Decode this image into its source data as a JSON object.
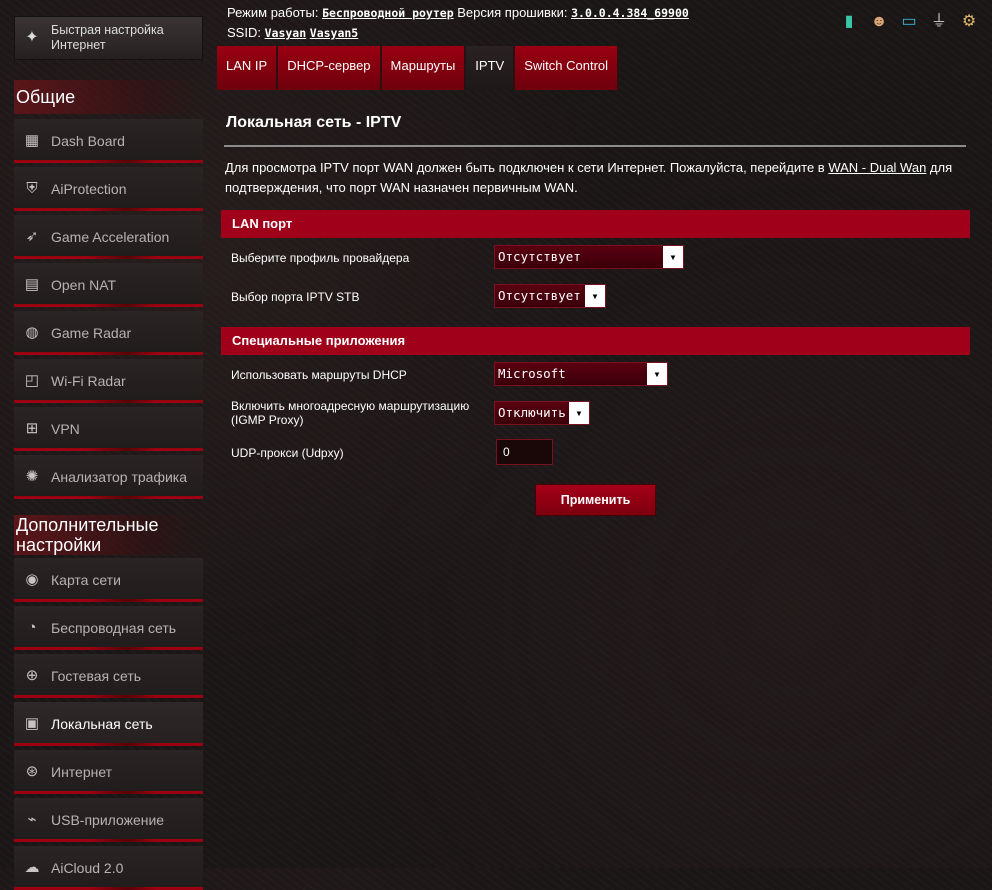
{
  "sidebar": {
    "quick_setup": {
      "label_line1": "Быстрая настройка",
      "label_line2": "Интернет",
      "icon": "wand-icon"
    },
    "general_title": "Общие",
    "general_items": [
      {
        "label": "Dash Board",
        "icon": "dashboard-icon"
      },
      {
        "label": "AiProtection",
        "icon": "shield-icon"
      },
      {
        "label": "Game Acceleration",
        "icon": "rocket-icon"
      },
      {
        "label": "Open NAT",
        "icon": "router-icon"
      },
      {
        "label": "Game Radar",
        "icon": "radar-icon"
      },
      {
        "label": "Wi-Fi Radar",
        "icon": "wifi-radar-icon"
      },
      {
        "label": "VPN",
        "icon": "vpn-icon"
      },
      {
        "label": "Анализатор трафика",
        "icon": "traffic-analyzer-icon"
      }
    ],
    "advanced_title_line1": "Дополнительные",
    "advanced_title_line2": "настройки",
    "advanced_items": [
      {
        "label": "Карта сети",
        "icon": "globe-map-icon"
      },
      {
        "label": "Беспроводная сеть",
        "icon": "wireless-icon"
      },
      {
        "label": "Гостевая сеть",
        "icon": "guest-network-icon"
      },
      {
        "label": "Локальная сеть",
        "icon": "lan-icon",
        "active": true
      },
      {
        "label": "Интернет",
        "icon": "internet-globe-icon"
      },
      {
        "label": "USB-приложение",
        "icon": "usb-icon"
      },
      {
        "label": "AiCloud 2.0",
        "icon": "cloud-icon"
      }
    ]
  },
  "header": {
    "mode_label": "Режим работы:",
    "mode_value": "Беспроводной роутер",
    "firmware_label": "Версия прошивки:",
    "firmware_value": "3.0.0.4.384_69900",
    "ssid_label": "SSID:",
    "ssid_values": [
      "Vasyan",
      "Vasyan5"
    ],
    "icons": [
      "phone-icon",
      "users-icon",
      "network-icon",
      "usb-status-icon",
      "settings-gear-icon"
    ]
  },
  "tabs": [
    {
      "label": "LAN IP"
    },
    {
      "label": "DHCP-сервер"
    },
    {
      "label": "Маршруты"
    },
    {
      "label": "IPTV",
      "active": true
    },
    {
      "label": "Switch Control"
    }
  ],
  "main": {
    "title": "Локальная сеть - IPTV",
    "desc_part1": "Для просмотра IPTV порт WAN должен быть подключен к сети Интернет. Пожалуйста, перейдите в ",
    "desc_link": "WAN - Dual Wan",
    "desc_part2": " для подтверждения, что порт WAN назначен первичным WAN.",
    "lan_port_section": "LAN порт",
    "provider_profile_label": "Выберите профиль провайдера",
    "provider_profile_value": "Отсутствует",
    "iptv_stb_label": "Выбор порта IPTV STB",
    "iptv_stb_value": "Отсутствует",
    "special_apps_section": "Специальные приложения",
    "dhcp_routes_label": "Использовать маршруты DHCP",
    "dhcp_routes_value": "Microsoft",
    "multicast_label_line1": "Включить многоадресную маршрутизацию",
    "multicast_label_line2": "(IGMP Proxy)",
    "multicast_value": "Отключить",
    "udpxy_label": "UDP-прокси (Udpxy)",
    "udpxy_value": "0",
    "apply_label": "Применить"
  }
}
